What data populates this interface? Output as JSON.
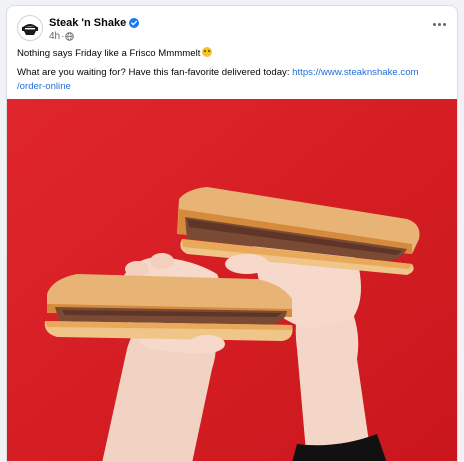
{
  "post": {
    "page_name": "Steak 'n Shake",
    "time": "4h",
    "separator": "·",
    "line1": "Nothing says Friday like a Frisco Mmmmelt",
    "line2_prefix": "What are you waiting for? Have this fan-favorite delivered today: ",
    "link_part1": "https://www.steaknshake.com",
    "link_part2": "/order-online"
  },
  "icons": {
    "verified": "verified-badge-icon",
    "audience": "globe-icon",
    "more": "more-options-icon",
    "emoji": "grinning-face-icon"
  },
  "colors": {
    "background": "#f0f2f5",
    "link": "#216fdb",
    "verified": "#1877f2",
    "photo_background": "#d71f26"
  }
}
